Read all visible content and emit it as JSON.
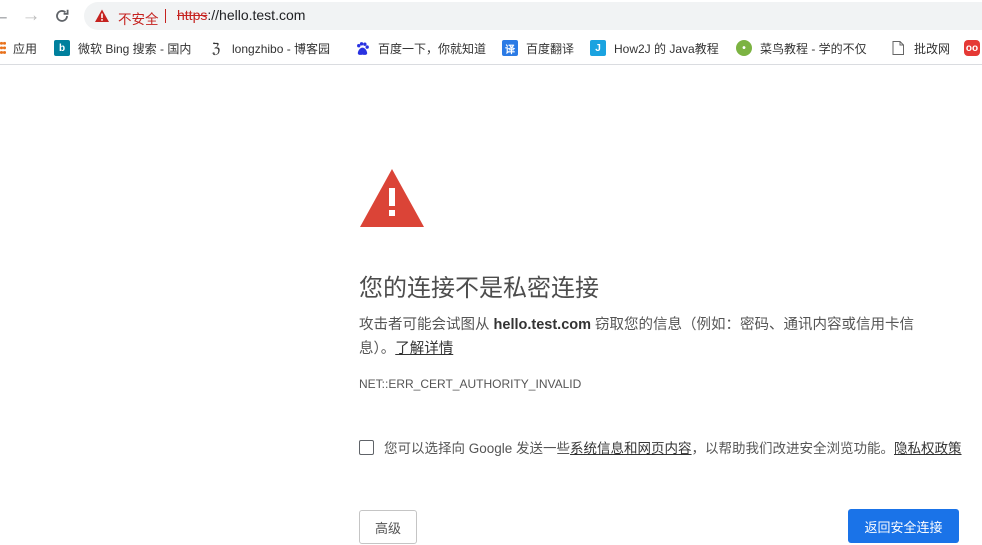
{
  "toolbar": {
    "insecure_label": "不安全",
    "url_scheme": "https",
    "url_rest": "://hello.test.com"
  },
  "bookmarks": [
    {
      "label": "应用",
      "icon": "apps-icon"
    },
    {
      "label": "微软 Bing 搜索 - 国内",
      "icon": "bing-icon"
    },
    {
      "label": "longzhibo - 博客园",
      "icon": "cnblogs-icon"
    },
    {
      "label": "百度一下，你就知道",
      "icon": "baidu-icon"
    },
    {
      "label": "百度翻译",
      "icon": "baidu-translate-icon"
    },
    {
      "label": "How2J 的 Java教程",
      "icon": "how2j-icon"
    },
    {
      "label": "菜鸟教程 - 学的不仅",
      "icon": "runoob-icon"
    },
    {
      "label": "批改网",
      "icon": "page-icon"
    },
    {
      "label": "",
      "icon": "owl-icon"
    }
  ],
  "main": {
    "heading": "您的连接不是私密连接",
    "desc_prefix": "攻击者可能会试图从 ",
    "desc_host": "hello.test.com",
    "desc_suffix": " 窃取您的信息（例如：密码、通讯内容或信用卡信息）。",
    "learn_more": "了解详情",
    "error_code": "NET::ERR_CERT_AUTHORITY_INVALID",
    "optin_prefix": "您可以选择向 Google 发送一些",
    "optin_link": "系统信息和网页内容",
    "optin_middle": "，以帮助我们改进安全浏览功能。",
    "optin_privacy": "隐私权政策",
    "optin_checked": false,
    "advanced_label": "高级",
    "back_label": "返回安全连接"
  },
  "colors": {
    "warning_red": "#db4437",
    "primary_blue": "#1a73e8"
  }
}
